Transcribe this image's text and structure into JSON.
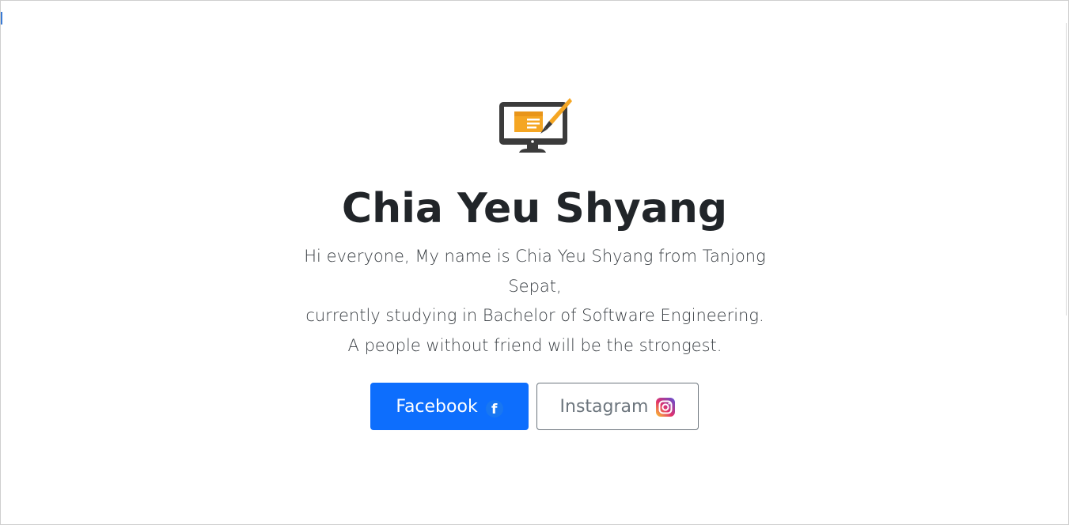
{
  "profile": {
    "name": "Chia Yeu Shyang",
    "intro_line1": "Hi everyone, My name is Chia Yeu Shyang from Tanjong",
    "intro_line2": "Sepat,",
    "intro_line3": "currently studying in Bachelor of Software Engineering.",
    "intro_line4": "A people without friend will be the strongest."
  },
  "logo": {
    "icon": "monitor-brush-icon",
    "colors": {
      "screen": "#3b3b3b",
      "accent": "#f5a623"
    }
  },
  "buttons": {
    "facebook": {
      "label": "Facebook",
      "icon": "facebook-icon",
      "color": "#0d6efd"
    },
    "instagram": {
      "label": "Instagram",
      "icon": "instagram-icon",
      "color": "#6c757d"
    }
  }
}
